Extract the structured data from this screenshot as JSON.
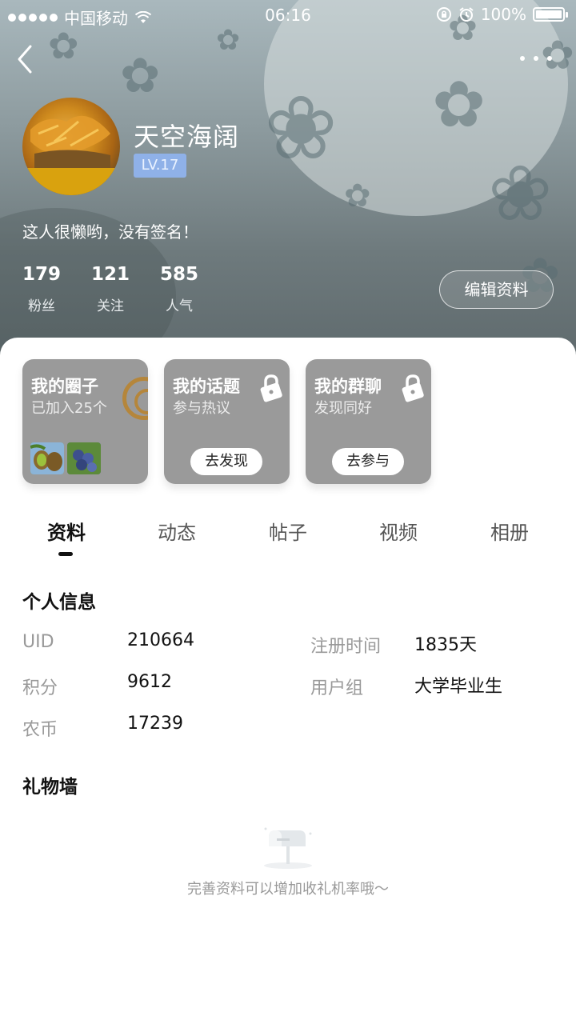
{
  "status_bar": {
    "carrier": "中国移动",
    "time": "06:16",
    "battery": "100%"
  },
  "profile": {
    "username": "天空海阔",
    "level": "LV.17",
    "signature": "这人很懒哟，没有签名！",
    "stats": [
      {
        "value": "179",
        "label": "粉丝"
      },
      {
        "value": "121",
        "label": "关注"
      },
      {
        "value": "585",
        "label": "人气"
      }
    ],
    "edit_button": "编辑资料"
  },
  "cards": [
    {
      "title": "我的圈子",
      "subtitle": "已加入25个"
    },
    {
      "title": "我的话题",
      "subtitle": "参与热议",
      "button": "去发现"
    },
    {
      "title": "我的群聊",
      "subtitle": "发现同好",
      "button": "去参与"
    }
  ],
  "tabs": [
    "资料",
    "动态",
    "帖子",
    "视频",
    "相册"
  ],
  "personal_info": {
    "title": "个人信息",
    "left": [
      {
        "label": "UID",
        "value": "210664"
      },
      {
        "label": "积分",
        "value": "9612"
      },
      {
        "label": "农币",
        "value": "17239"
      }
    ],
    "right": [
      {
        "label": "注册时间",
        "value": "1835天"
      },
      {
        "label": "用户组",
        "value": "大学毕业生"
      }
    ]
  },
  "gift_wall": {
    "title": "礼物墙",
    "empty_text": "完善资料可以增加收礼机率哦～"
  },
  "colors": {
    "level_badge": "#8fb1e8",
    "card_bg": "#9a9a9a",
    "header_bg": "#8d9b9f"
  }
}
